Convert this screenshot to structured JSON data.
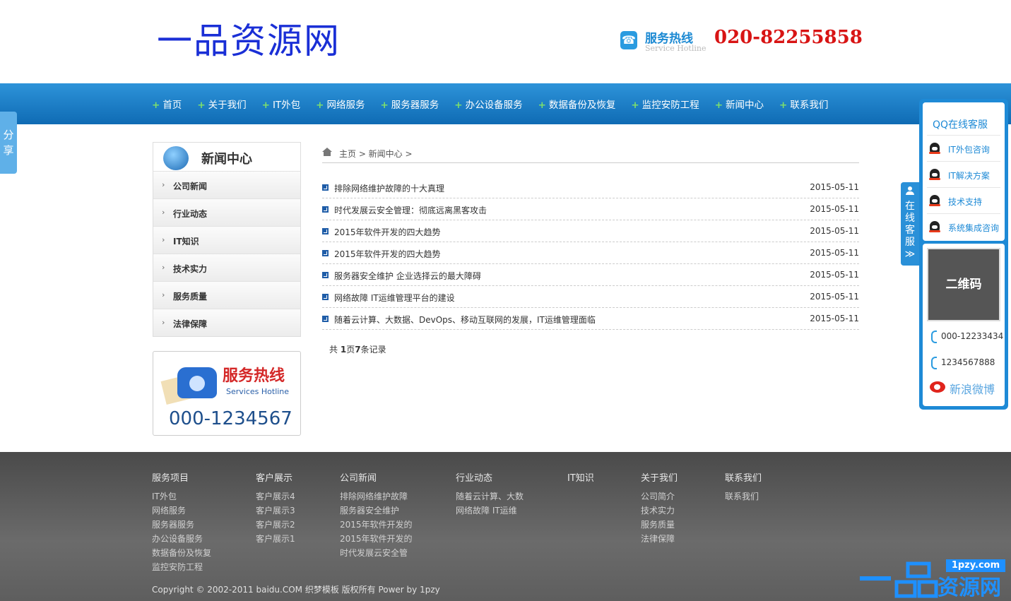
{
  "header": {
    "logo": "一品资源网",
    "hotline_cn": "服务热线",
    "hotline_en": "Service Hotline",
    "hotline_number": "020-82255858"
  },
  "nav": [
    "首页",
    "关于我们",
    "IT外包",
    "网络服务",
    "服务器服务",
    "办公设备服务",
    "数据备份及恢复",
    "监控安防工程",
    "新闻中心",
    "联系我们"
  ],
  "share_tab": "分享",
  "sidebar": {
    "title": "新闻中心",
    "items": [
      "公司新闻",
      "行业动态",
      "IT知识",
      "技术实力",
      "服务质量",
      "法律保障"
    ],
    "hotline_card": {
      "cn": "服务热线",
      "en": "Services Hotline",
      "number": "000-1234567"
    }
  },
  "breadcrumb": {
    "text": "主页 > 新闻中心 >"
  },
  "news": [
    {
      "title": "排除网络维护故障的十大真理",
      "date": "2015-05-11"
    },
    {
      "title": "时代发展云安全管理：彻底远离黑客攻击",
      "date": "2015-05-11"
    },
    {
      "title": "2015年软件开发的四大趋势",
      "date": "2015-05-11"
    },
    {
      "title": "2015年软件开发的四大趋势",
      "date": "2015-05-11"
    },
    {
      "title": "服务器安全维护 企业选择云的最大障碍",
      "date": "2015-05-11"
    },
    {
      "title": "网络故障 IT运维管理平台的建设",
      "date": "2015-05-11"
    },
    {
      "title": "随着云计算、大数据、DevOps、移动互联网的发展，IT运维管理面临",
      "date": "2015-05-11"
    }
  ],
  "pager": {
    "prefix": "共 ",
    "pages": "1",
    "mid": "页",
    "records": "7",
    "suffix": "条记录"
  },
  "service": {
    "tab_label": "在线客服",
    "tab_arrow": "≫",
    "qq_title": "QQ在线客服",
    "qq_items": [
      "IT外包咨询",
      "IT解决方案",
      "技术支持",
      "系统集成咨询"
    ],
    "qrcode": "二维码",
    "phones": [
      "000-12233434",
      "1234567888"
    ],
    "weibo": "新浪微博"
  },
  "footer": {
    "columns": [
      {
        "title": "服务项目",
        "items": [
          "IT外包",
          "网络服务",
          "服务器服务",
          "办公设备服务",
          "数据备份及恢复",
          "监控安防工程"
        ]
      },
      {
        "title": "客户展示",
        "items": [
          "客户展示4",
          "客户展示3",
          "客户展示2",
          "客户展示1"
        ]
      },
      {
        "title": "公司新闻",
        "items": [
          "排除网络维护故障",
          "服务器安全维护",
          "2015年软件开发的",
          "2015年软件开发的",
          "时代发展云安全管"
        ]
      },
      {
        "title": "行业动态",
        "items": [
          "随着云计算、大数",
          "网络故障 IT运维"
        ]
      },
      {
        "title": "IT知识",
        "items": []
      },
      {
        "title": "关于我们",
        "items": [
          "公司简介",
          "技术实力",
          "服务质量",
          "法律保障"
        ]
      },
      {
        "title": "联系我们",
        "items": [
          "联系我们"
        ]
      }
    ],
    "copyright": "Copyright © 2002-2011 baidu.COM 织梦模板 版权所有 Power by 1pzy",
    "watermark_url": "1pzy.com",
    "watermark_text": "资源网"
  }
}
